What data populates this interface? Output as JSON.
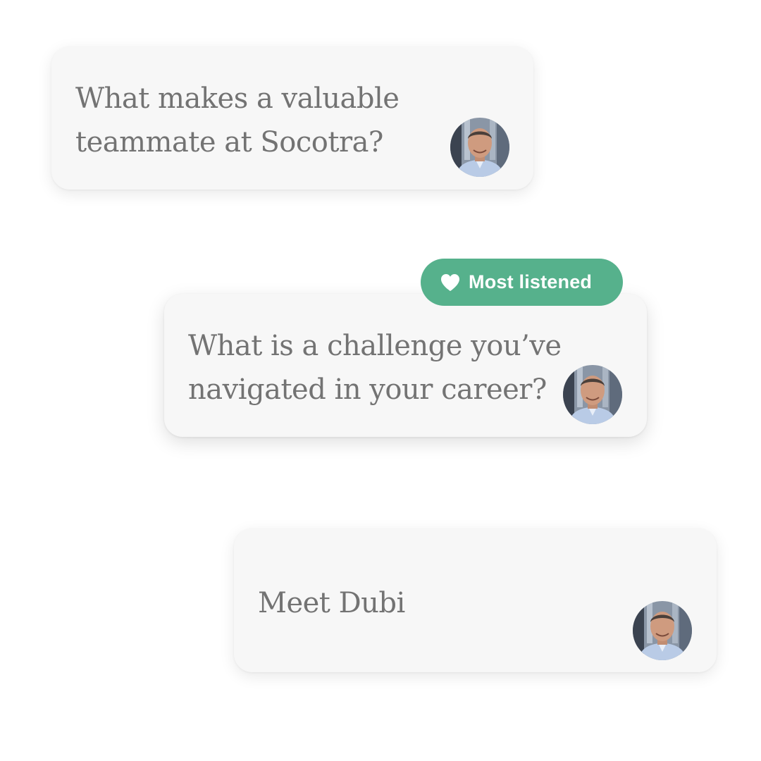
{
  "cards": [
    {
      "question": "What makes a valuable teammate at Socotra?",
      "avatar_icon": "person-avatar-icon"
    },
    {
      "question": "What is a challenge you’ve navigated in your career?",
      "avatar_icon": "person-avatar-icon"
    },
    {
      "question": "Meet Dubi",
      "avatar_icon": "person-avatar-icon"
    }
  ],
  "badge": {
    "label": "Most listened",
    "icon": "heart-icon",
    "color": "#56b18c"
  },
  "colors": {
    "card_background": "#f7f7f7",
    "text": "#737373",
    "page_background": "#ffffff"
  }
}
